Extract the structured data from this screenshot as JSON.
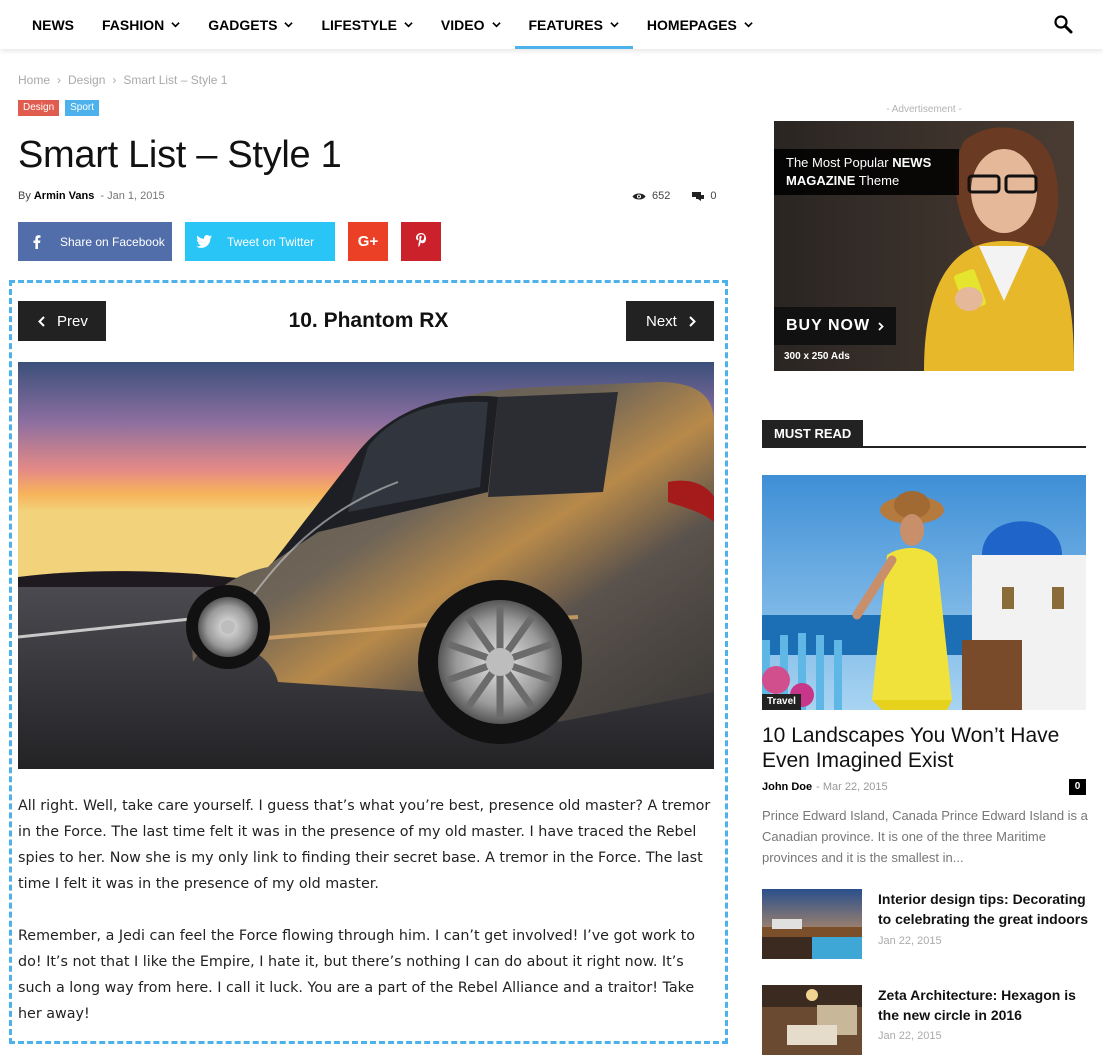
{
  "nav": {
    "items": [
      {
        "label": "NEWS",
        "dropdown": false
      },
      {
        "label": "FASHION",
        "dropdown": true
      },
      {
        "label": "GADGETS",
        "dropdown": true
      },
      {
        "label": "LIFESTYLE",
        "dropdown": true
      },
      {
        "label": "VIDEO",
        "dropdown": true
      },
      {
        "label": "FEATURES",
        "dropdown": true,
        "active": true
      },
      {
        "label": "HOMEPAGES",
        "dropdown": true
      }
    ],
    "search_icon": "search-icon",
    "accent": "#4db2ec"
  },
  "breadcrumb": {
    "home": "Home",
    "section": "Design",
    "current": "Smart List – Style 1",
    "sep": "›"
  },
  "categories": [
    {
      "label": "Design",
      "color": "#e05c4f"
    },
    {
      "label": "Sport",
      "color": "#4db2ec"
    }
  ],
  "post": {
    "title": "Smart List – Style 1",
    "by": "By",
    "author": "Armin Vans",
    "date": "- Jan 1, 2015",
    "views": "652",
    "comments": "0"
  },
  "share": {
    "facebook": "Share on Facebook",
    "twitter": "Tweet on Twitter",
    "colors": {
      "facebook": "#516eab",
      "twitter": "#29c5f6",
      "googleplus": "#eb4026",
      "pinterest": "#ca212a"
    }
  },
  "smartlist": {
    "prev": "Prev",
    "next": "Next",
    "item_title": "10. Phantom RX",
    "paragraphs": [
      "All right. Well, take care yourself. I guess that’s what you’re best, presence old master? A tremor in the Force. The last time felt it was in the presence of my old master. I have traced the Rebel spies to her. Now she is my only link to finding their secret base. A tremor in the Force. The last time I felt it was in the presence of my old master.",
      "Remember, a Jedi can feel the Force flowing through him. I can’t get involved! I’ve got work to do! It’s not that I like the Empire, I hate it, but there’s nothing I can do about it right now. It’s such a long way from here. I call it luck. You are a part of the Rebel Alliance and a traitor! Take her away!"
    ]
  },
  "sidebar": {
    "ad_label": "- Advertisement -",
    "ad_headline_pre": "The Most Popular",
    "ad_headline_bold1": "NEWS",
    "ad_headline_bold2": "MAGAZINE",
    "ad_headline_post": "Theme",
    "ad_buy": "BUY NOW",
    "ad_size": "300 x 250 Ads",
    "block_title": "MUST READ",
    "featured": {
      "category": "Travel",
      "title": "10 Landscapes You Won’t Have Even Imagined Exist",
      "author": "John Doe",
      "date": "- Mar 22, 2015",
      "comments": "0",
      "excerpt": "Prince Edward Island, Canada Prince Edward Island is a Canadian province. It is one of the three Maritime provinces and it is the smallest in..."
    },
    "list": [
      {
        "title": "Interior design tips: Decorating to celebrating the great indoors",
        "date": "Jan 22, 2015"
      },
      {
        "title": "Zeta Architecture: Hexagon is the new circle in 2016",
        "date": "Jan 22, 2015"
      }
    ]
  }
}
